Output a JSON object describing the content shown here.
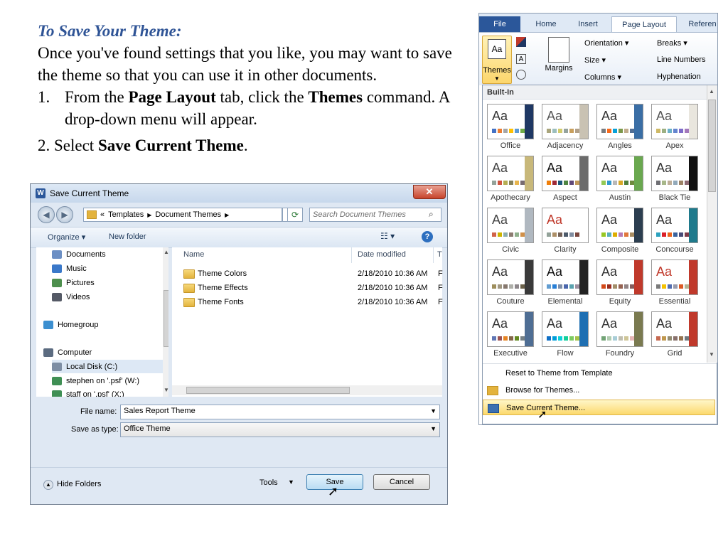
{
  "slide": {
    "title": "To Save Your Theme:",
    "intro": "Once you've found settings that you like, you may want to save the theme so that you can use it in other documents.",
    "step1_num": "1.",
    "step1_pre": "From the ",
    "step1_b1": "Page Layout",
    "step1_mid": " tab, click the ",
    "step1_b2": "Themes",
    "step1_post": " command. A drop-down menu will appear.",
    "step2_pre": "2. Select ",
    "step2_b": "Save Current Theme",
    "step2_post": "."
  },
  "dialog": {
    "title": "Save Current Theme",
    "close": "✕",
    "address": {
      "chevron": "«",
      "part1": "Templates",
      "part2": "Document Themes"
    },
    "search_placeholder": "Search Document Themes",
    "toolbar": {
      "organize": "Organize ▾",
      "new_folder": "New folder"
    },
    "nav": [
      {
        "label": "Documents",
        "color": "#6c8fc4"
      },
      {
        "label": "Music",
        "color": "#3a78c9"
      },
      {
        "label": "Pictures",
        "color": "#4d8f4d"
      },
      {
        "label": "Videos",
        "color": "#555a66"
      },
      {
        "label": "Homegroup",
        "color": "#3c8fd0"
      },
      {
        "label": "Computer",
        "color": "#5b6b80"
      },
      {
        "label": "Local Disk (C:)",
        "color": "#7e8ea4"
      },
      {
        "label": "stephen on '.psf' (W:)",
        "color": "#3f8f54"
      },
      {
        "label": "staff on '.psf' (X:)",
        "color": "#3f8f54"
      }
    ],
    "columns": {
      "name": "Name",
      "date": "Date modified",
      "type": "T"
    },
    "files": [
      {
        "name": "Theme Colors",
        "date": "2/18/2010 10:36 AM",
        "type": "F"
      },
      {
        "name": "Theme Effects",
        "date": "2/18/2010 10:36 AM",
        "type": "F"
      },
      {
        "name": "Theme Fonts",
        "date": "2/18/2010 10:36 AM",
        "type": "F"
      }
    ],
    "file_name_label": "File name:",
    "file_name_value": "Sales Report Theme",
    "save_type_label": "Save as type:",
    "save_type_value": "Office Theme",
    "hide_folders": "Hide Folders",
    "tools": "Tools",
    "save": "Save",
    "cancel": "Cancel"
  },
  "ribbon": {
    "tabs": [
      "File",
      "Home",
      "Insert",
      "Page Layout",
      "Referen"
    ],
    "themes_label": "Themes",
    "margins_label": "Margins",
    "orientation": "Orientation ▾",
    "size": "Size ▾",
    "columns": "Columns ▾",
    "breaks": "Breaks ▾",
    "line_numbers": "Line Numbers",
    "hyphenation": "Hyphenation",
    "menu_header": "Built-In",
    "themes": [
      {
        "name": "Office",
        "accent": "#1f3864",
        "aa": "#333",
        "sw": [
          "#4472c4",
          "#ed7d31",
          "#a5a5a5",
          "#ffc000",
          "#5b9bd5",
          "#70ad47"
        ]
      },
      {
        "name": "Adjacency",
        "accent": "#c9c2b3",
        "aa": "#555",
        "sw": [
          "#a9a57c",
          "#9cbebd",
          "#d2cb6c",
          "#95a39d",
          "#c89f5d",
          "#b1a089"
        ]
      },
      {
        "name": "Angles",
        "accent": "#3a6ea5",
        "aa": "#333",
        "sw": [
          "#797b7e",
          "#f96a1b",
          "#08a1d9",
          "#7c984a",
          "#c2ad8d",
          "#506e94"
        ]
      },
      {
        "name": "Apex",
        "accent": "#e9e6de",
        "aa": "#555",
        "sw": [
          "#ceb966",
          "#9cb084",
          "#6bb1c9",
          "#6585cf",
          "#7e6bc9",
          "#a379bb"
        ]
      },
      {
        "name": "Apothecary",
        "accent": "#c8b87a",
        "aa": "#444",
        "sw": [
          "#93a299",
          "#cf543f",
          "#b5ae53",
          "#848058",
          "#e8b54d",
          "#786c71"
        ]
      },
      {
        "name": "Aspect",
        "accent": "#6b6b6b",
        "aa": "#111",
        "sw": [
          "#f07f09",
          "#9f2936",
          "#1b587c",
          "#4e8542",
          "#604878",
          "#c19859"
        ]
      },
      {
        "name": "Austin",
        "accent": "#6aa84f",
        "aa": "#333",
        "sw": [
          "#94c954",
          "#3399cc",
          "#b8b8b8",
          "#d8a827",
          "#4f7f3d",
          "#6e8b3d"
        ]
      },
      {
        "name": "Black Tie",
        "accent": "#111111",
        "aa": "#333",
        "sw": [
          "#6f6f74",
          "#a7b789",
          "#beae98",
          "#92a9b9",
          "#9c8265",
          "#8d6974"
        ]
      },
      {
        "name": "Civic",
        "accent": "#b0b8c0",
        "aa": "#444",
        "sw": [
          "#d16349",
          "#ccb400",
          "#8cadae",
          "#8c7b70",
          "#8fb08c",
          "#d19049"
        ]
      },
      {
        "name": "Clarity",
        "accent": "#ffffff",
        "aa": "#c0392b",
        "sw": [
          "#93a299",
          "#ad8f67",
          "#726056",
          "#4c5a6a",
          "#808da0",
          "#79463d"
        ]
      },
      {
        "name": "Composite",
        "accent": "#2c3e50",
        "aa": "#333",
        "sw": [
          "#98c723",
          "#59b0b9",
          "#deae00",
          "#b77bb4",
          "#e0773c",
          "#a98d63"
        ]
      },
      {
        "name": "Concourse",
        "accent": "#1f7a8c",
        "aa": "#333",
        "sw": [
          "#2da2bf",
          "#da1f28",
          "#eb641b",
          "#39639d",
          "#474b78",
          "#7d3c4a"
        ]
      },
      {
        "name": "Couture",
        "accent": "#3a3a3a",
        "aa": "#333",
        "sw": [
          "#9e8e5c",
          "#a09781",
          "#85776d",
          "#aeafa9",
          "#8d878b",
          "#6b6149"
        ]
      },
      {
        "name": "Elemental",
        "accent": "#222222",
        "aa": "#111",
        "sw": [
          "#629dd1",
          "#297fd5",
          "#7f8fa9",
          "#4a66ac",
          "#5aa2ae",
          "#9d90a0"
        ]
      },
      {
        "name": "Equity",
        "accent": "#c0392b",
        "aa": "#333",
        "sw": [
          "#d34817",
          "#9b2d1f",
          "#a28e6a",
          "#956251",
          "#918485",
          "#855d5d"
        ]
      },
      {
        "name": "Essential",
        "accent": "#c0392b",
        "aa": "#c0392b",
        "sw": [
          "#7a7a7a",
          "#f5c201",
          "#526db0",
          "#989aac",
          "#dc5924",
          "#b4b392"
        ]
      },
      {
        "name": "Executive",
        "accent": "#4f6e94",
        "aa": "#333",
        "sw": [
          "#6076b4",
          "#9c5252",
          "#e68422",
          "#846648",
          "#63891f",
          "#758085"
        ]
      },
      {
        "name": "Flow",
        "accent": "#1f6fb2",
        "aa": "#333",
        "sw": [
          "#0f6fc6",
          "#009dd9",
          "#0bd0d9",
          "#10cf9b",
          "#7cca62",
          "#a5c249"
        ]
      },
      {
        "name": "Foundry",
        "accent": "#7a7a50",
        "aa": "#333",
        "sw": [
          "#72a376",
          "#b0ccb0",
          "#a8cdd7",
          "#c0beaf",
          "#cec597",
          "#e8b7b7"
        ]
      },
      {
        "name": "Grid",
        "accent": "#c0392b",
        "aa": "#333",
        "sw": [
          "#c66951",
          "#bf974d",
          "#928b70",
          "#87706b",
          "#94734e",
          "#6f777d"
        ]
      }
    ],
    "commands": {
      "reset": "Reset to Theme from Template",
      "browse": "Browse for Themes...",
      "save": "Save Current Theme..."
    }
  }
}
